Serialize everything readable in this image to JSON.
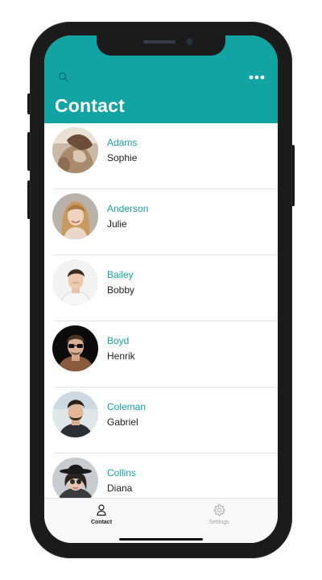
{
  "header": {
    "title": "Contact",
    "search_icon": "search-icon",
    "more_icon": "more-horizontal-icon"
  },
  "theme": {
    "accent": "#12a3a3",
    "name_color": "#1da0a3"
  },
  "contacts": [
    {
      "last_name": "Adams",
      "first_name": "Sophie"
    },
    {
      "last_name": "Anderson",
      "first_name": "Julie"
    },
    {
      "last_name": "Bailey",
      "first_name": "Bobby"
    },
    {
      "last_name": "Boyd",
      "first_name": "Henrik"
    },
    {
      "last_name": "Coleman",
      "first_name": "Gabriel"
    },
    {
      "last_name": "Collins",
      "first_name": "Diana"
    }
  ],
  "tabbar": {
    "contact_label": "Contact",
    "settings_label": "Settings",
    "contact_icon": "person-icon",
    "settings_icon": "gear-icon",
    "active": "Contact"
  }
}
